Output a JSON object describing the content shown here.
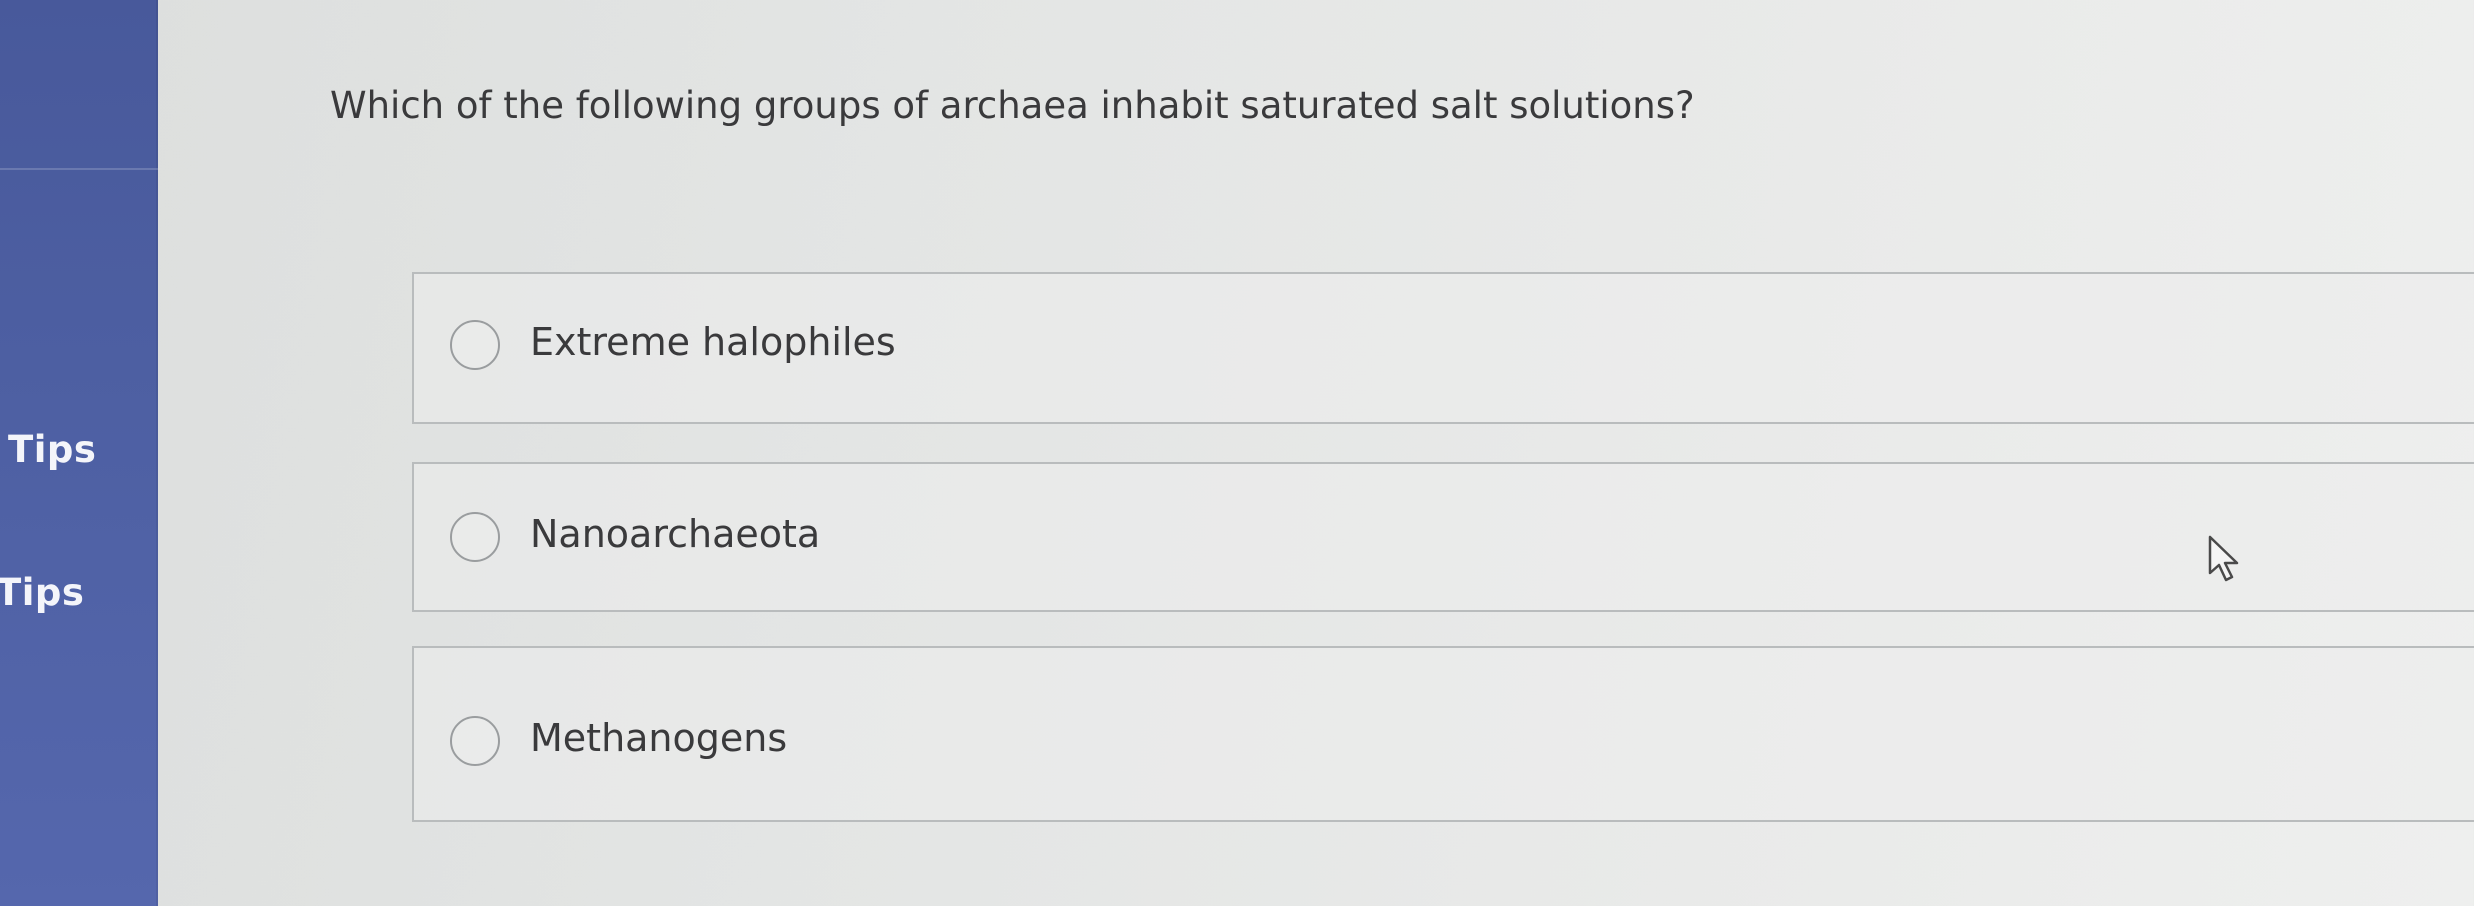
{
  "sidebar": {
    "tips_labels": [
      "Tips",
      "Tips"
    ],
    "color": "#4d5fa2"
  },
  "question": {
    "text": "Which of the following groups of archaea inhabit saturated salt solutions?"
  },
  "options": [
    {
      "label": "Extreme halophiles",
      "selected": false
    },
    {
      "label": "Nanoarchaeota",
      "selected": false
    },
    {
      "label": "Methanogens",
      "selected": false
    }
  ],
  "cursor": {
    "icon": "arrow-pointer-icon"
  }
}
